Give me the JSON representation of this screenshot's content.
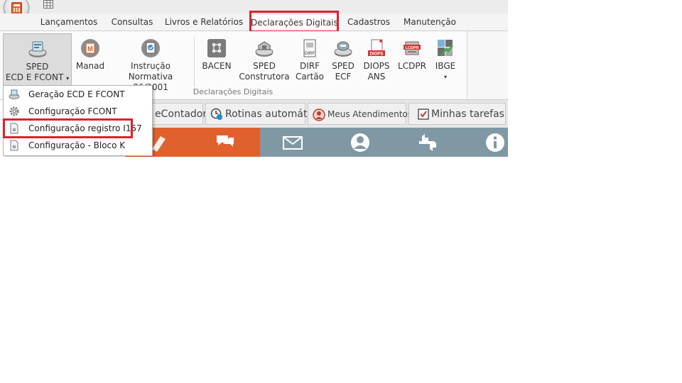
{
  "tabs": [
    {
      "label": "Lançamentos"
    },
    {
      "label": "Consultas"
    },
    {
      "label": "Livros e Relatórios"
    },
    {
      "label": "Declarações Digitais"
    },
    {
      "label": "Cadastros"
    },
    {
      "label": "Manutenção"
    }
  ],
  "ribbon": {
    "buttons": [
      {
        "line1": "SPED",
        "line2": "ECD E FCONT",
        "icon": "sped-disc-icon"
      },
      {
        "line1": "Manad",
        "line2": "",
        "icon": "manad-icon"
      },
      {
        "line1": "Instrução",
        "line2": "Normativa 86/2001",
        "icon": "instrucao-disc-icon"
      },
      {
        "line1": "BACEN",
        "line2": "",
        "icon": "bacen-icon"
      },
      {
        "line1": "SPED",
        "line2": "Construtora",
        "icon": "sped-construtora-icon"
      },
      {
        "line1": "DIRF",
        "line2": "Cartão",
        "icon": "dirf-card-icon"
      },
      {
        "line1": "SPED",
        "line2": "ECF",
        "icon": "sped-ecf-icon"
      },
      {
        "line1": "DIOPS",
        "line2": "ANS",
        "icon": "diops-icon"
      },
      {
        "line1": "LCDPR",
        "line2": "",
        "icon": "lcdpr-icon"
      },
      {
        "line1": "IBGE",
        "line2": "",
        "icon": "ibge-icon"
      }
    ],
    "group_label": "Declarações Digitais",
    "icon_texts": {
      "manad": "M",
      "dirf": "DIRF",
      "diops": "DIOPS",
      "lcdpr": "LCDPR"
    }
  },
  "dropdown": {
    "items": [
      {
        "label": "Geração ECD E FCONT",
        "icon": "sped-disc-icon"
      },
      {
        "label": "Configuração FCONT",
        "icon": "gear-icon"
      },
      {
        "label": "Configuração registro I157",
        "icon": "document-icon"
      },
      {
        "label": "Configuração - Bloco K",
        "icon": "document-icon"
      }
    ]
  },
  "lower_tabs": [
    {
      "label": "eContador"
    },
    {
      "label": "Rotinas automáticas"
    },
    {
      "label": "Meus Atendimentos"
    },
    {
      "label": "Minhas tarefas"
    }
  ],
  "colors": {
    "highlight": "#e0202e",
    "orange_bar": "#e0612d",
    "grey_bar": "#7f98a4"
  }
}
